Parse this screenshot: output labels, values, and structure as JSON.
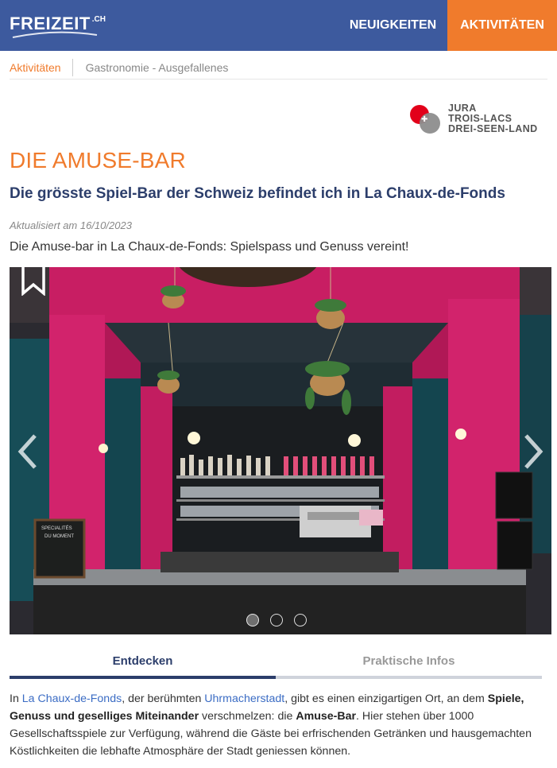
{
  "header": {
    "logo_text": "FREIZEIT",
    "logo_suffix": ".CH",
    "nav": [
      "NEUIGKEITEN",
      "AKTIVITÄTEN"
    ],
    "brand_color": "#3d5a9e",
    "accent_color": "#f07b2c"
  },
  "breadcrumb": [
    "Aktivitäten",
    "Gastronomie - Ausgefallenes"
  ],
  "sponsor": {
    "lines": [
      "JURA",
      "TROIS-LACS",
      "DREI-SEEN-LAND"
    ]
  },
  "article": {
    "title": "DIE AMUSE-BAR",
    "subtitle": "Die grösste Spiel-Bar der Schweiz befindet ich in La Chaux-de-Fonds",
    "updated": "Aktualisiert am 16/10/2023",
    "lead": "Die Amuse-bar in La Chaux-de-Fonds: Spielspass und Genuss vereint!"
  },
  "gallery": {
    "image_icon": "bar-photo",
    "slides": 3,
    "active_slide": 1,
    "chalkboard_text": [
      "SPECIALITÉS",
      "DU MOMENT"
    ]
  },
  "tabs": [
    "Entdecken",
    "Praktische Infos"
  ],
  "body": {
    "p1": "In ",
    "link1": "La Chaux-de-Fonds",
    "p2": ", der berühmten ",
    "link2": "Uhrmacherstadt",
    "p3": ", gibt es einen einzigartigen Ort, an dem ",
    "bold1": "Spiele, Genuss und geselliges Miteinander",
    "p4": " verschmelzen: die ",
    "bold2": "Amuse-Bar",
    "p5": ". Hier stehen über 1000 Gesellschaftsspiele zur Verfügung, während die Gäste bei erfrischenden Getränken und hausgemachten Köstlichkeiten die lebhafte Atmosphäre der Stadt geniessen können."
  }
}
